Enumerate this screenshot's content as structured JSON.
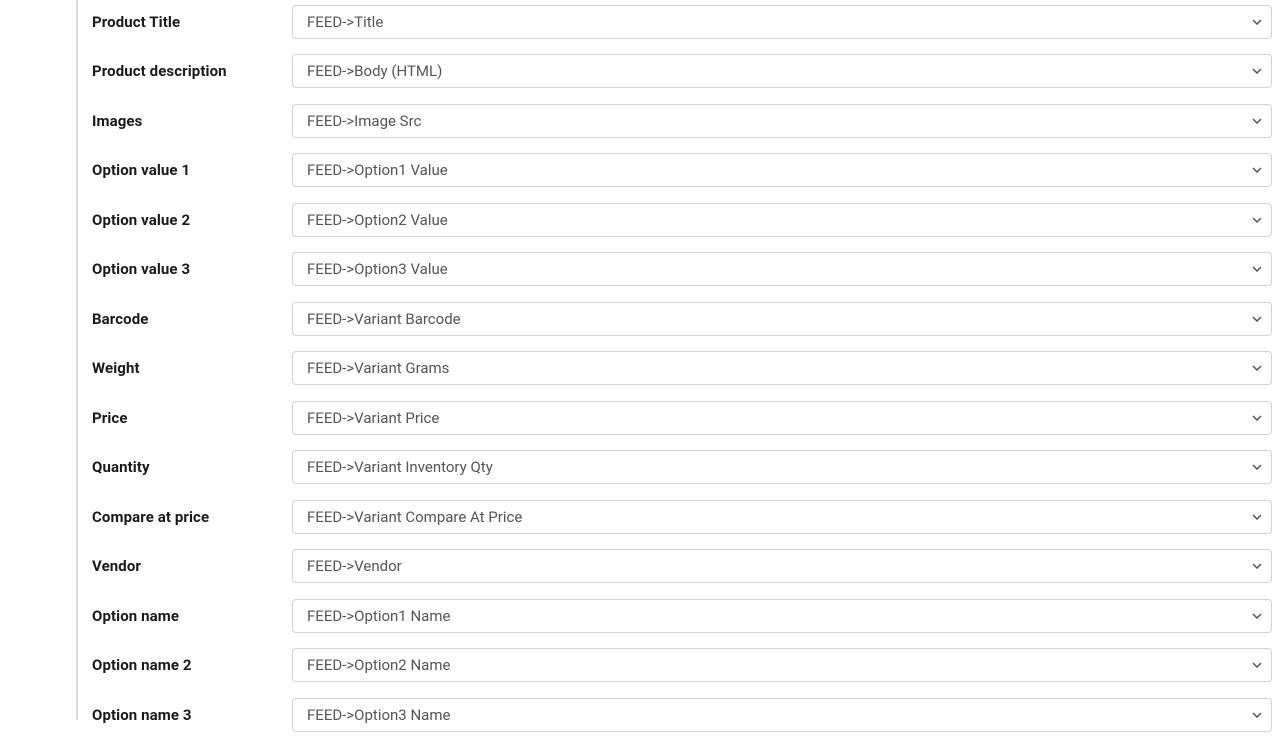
{
  "fields": [
    {
      "key": "product-title",
      "label": "Product Title",
      "value": "FEED->Title"
    },
    {
      "key": "product-description",
      "label": "Product description",
      "value": "FEED->Body (HTML)"
    },
    {
      "key": "images",
      "label": "Images",
      "value": "FEED->Image Src"
    },
    {
      "key": "option-value-1",
      "label": "Option value 1",
      "value": "FEED->Option1 Value"
    },
    {
      "key": "option-value-2",
      "label": "Option value 2",
      "value": "FEED->Option2 Value"
    },
    {
      "key": "option-value-3",
      "label": "Option value 3",
      "value": "FEED->Option3 Value"
    },
    {
      "key": "barcode",
      "label": "Barcode",
      "value": "FEED->Variant Barcode"
    },
    {
      "key": "weight",
      "label": "Weight",
      "value": "FEED->Variant Grams"
    },
    {
      "key": "price",
      "label": "Price",
      "value": "FEED->Variant Price"
    },
    {
      "key": "quantity",
      "label": "Quantity",
      "value": "FEED->Variant Inventory Qty"
    },
    {
      "key": "compare-at-price",
      "label": "Compare at price",
      "value": "FEED->Variant Compare At Price"
    },
    {
      "key": "vendor",
      "label": "Vendor",
      "value": "FEED->Vendor"
    },
    {
      "key": "option-name",
      "label": "Option name",
      "value": "FEED->Option1 Name"
    },
    {
      "key": "option-name-2",
      "label": "Option name 2",
      "value": "FEED->Option2 Name"
    },
    {
      "key": "option-name-3",
      "label": "Option name 3",
      "value": "FEED->Option3 Name"
    }
  ]
}
